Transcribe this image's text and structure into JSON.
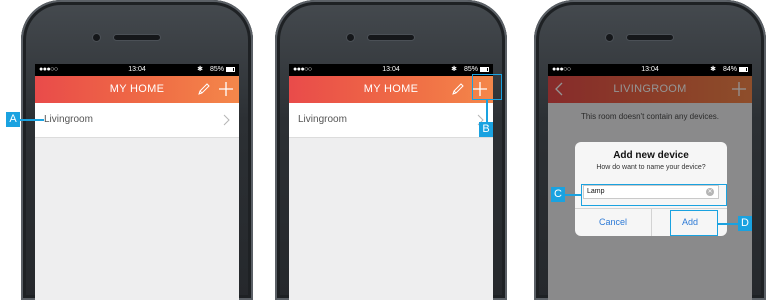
{
  "status_bar": {
    "signal": "●●●○○",
    "time": "13:04",
    "bluetooth": "✱",
    "screens": [
      {
        "battery": "85%",
        "battery_fraction": 0.85
      },
      {
        "battery": "85%",
        "battery_fraction": 0.85
      },
      {
        "battery": "84%",
        "battery_fraction": 0.84
      }
    ]
  },
  "screen1": {
    "title": "MY HOME",
    "room_label": "Livingroom",
    "icons": [
      "pencil-icon",
      "plus-icon",
      "chevron-right-icon"
    ]
  },
  "screen2": {
    "title": "MY HOME",
    "room_label": "Livingroom",
    "icons": [
      "pencil-icon",
      "plus-icon",
      "chevron-right-icon"
    ]
  },
  "screen3": {
    "title": "LIVINGROOM",
    "empty_message": "This room doesn't contain any devices.",
    "icons": [
      "back-chevron-icon",
      "plus-icon"
    ],
    "dialog": {
      "title": "Add new device",
      "subtitle": "How do want to name your device?",
      "input_value": "Lamp",
      "cancel_label": "Cancel",
      "add_label": "Add"
    }
  },
  "callouts": {
    "a": "A",
    "b": "B",
    "c": "C",
    "d": "D"
  },
  "colors": {
    "header_gradient_start": "#e94b4a",
    "header_gradient_end": "#f4874a",
    "callout": "#1aa2e0",
    "dialog_button_text": "#2d7ad6"
  }
}
